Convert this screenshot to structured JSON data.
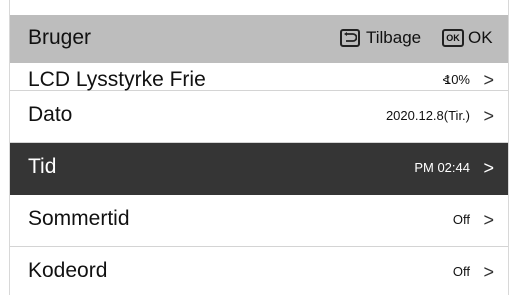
{
  "header": {
    "title": "Bruger",
    "back_label": "Tilbage",
    "ok_box": "OK",
    "ok_label": "OK"
  },
  "rows": [
    {
      "label": "LCD Lysstyrke Frie",
      "value": "10%",
      "prev": "<",
      "chevron": ">"
    },
    {
      "label": "Dato",
      "value": "2020.12.8(Tir.)",
      "chevron": ">"
    },
    {
      "label": "Tid",
      "value": "PM 02:44",
      "chevron": ">"
    },
    {
      "label": "Sommertid",
      "value": "Off",
      "chevron": ">"
    },
    {
      "label": "Kodeord",
      "value": "Off",
      "chevron": ">"
    }
  ],
  "colors": {
    "header_bg": "#bdbdbd",
    "selected_bg": "#353535"
  }
}
